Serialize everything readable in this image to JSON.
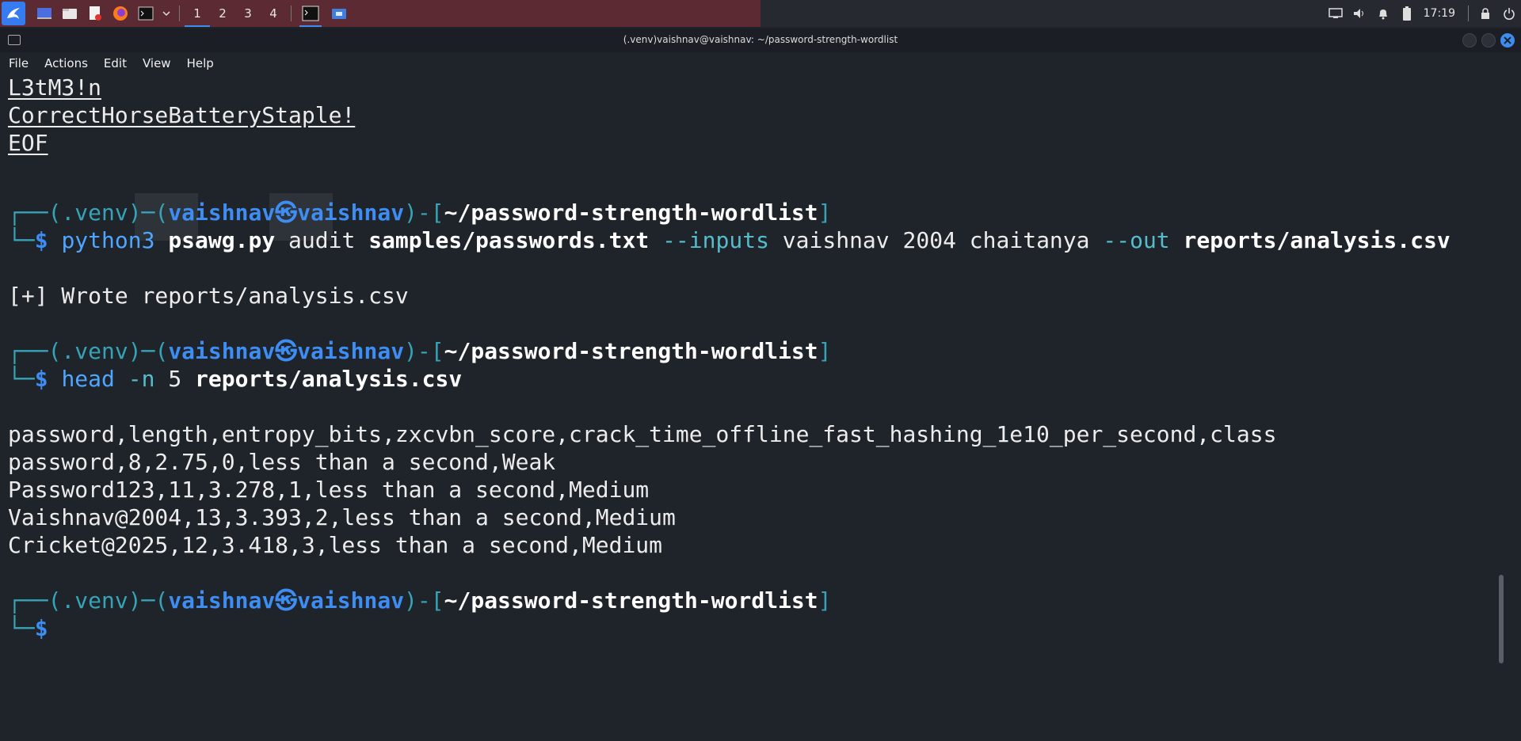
{
  "taskbar": {
    "workspaces": [
      "1",
      "2",
      "3",
      "4"
    ],
    "clock": "17:19"
  },
  "window": {
    "title": "(.venv)vaishnav@vaishnav: ~/password-strength-wordlist",
    "menu": [
      "File",
      "Actions",
      "Edit",
      "View",
      "Help"
    ]
  },
  "terminal": {
    "heredoc_lines": [
      "L3tM3!n",
      "CorrectHorseBatteryStaple!",
      "EOF"
    ],
    "prompt": {
      "venv": "(.venv)",
      "user": "vaishnav",
      "host": "vaishnav",
      "path": "~/password-strength-wordlist",
      "symbol": "$"
    },
    "cmd1": {
      "program": "python3",
      "script": "psawg.py",
      "subcommand": "audit",
      "file": "samples/passwords.txt",
      "flag_inputs": "--inputs",
      "inputs": "vaishnav 2004 chaitanya",
      "flag_out": "--out",
      "out": "reports/analysis.csv"
    },
    "output1": "[+] Wrote reports/analysis.csv",
    "cmd2": {
      "program": "head",
      "flag": "-n",
      "count": "5",
      "file": "reports/analysis.csv"
    },
    "csv_lines": [
      "password,length,entropy_bits,zxcvbn_score,crack_time_offline_fast_hashing_1e10_per_second,class",
      "password,8,2.75,0,less than a second,Weak",
      "Password123,11,3.278,1,less than a second,Medium",
      "Vaishnav@2004,13,3.393,2,less than a second,Medium",
      "Cricket@2025,12,3.418,3,less than a second,Medium"
    ]
  },
  "colors": {
    "terminal_bg": "#1f232a",
    "prompt_teal": "#36a3b6",
    "prompt_blue": "#3d8df2",
    "command_blue": "#4fa6ff",
    "titlebar_close": "#3b8ef0"
  }
}
